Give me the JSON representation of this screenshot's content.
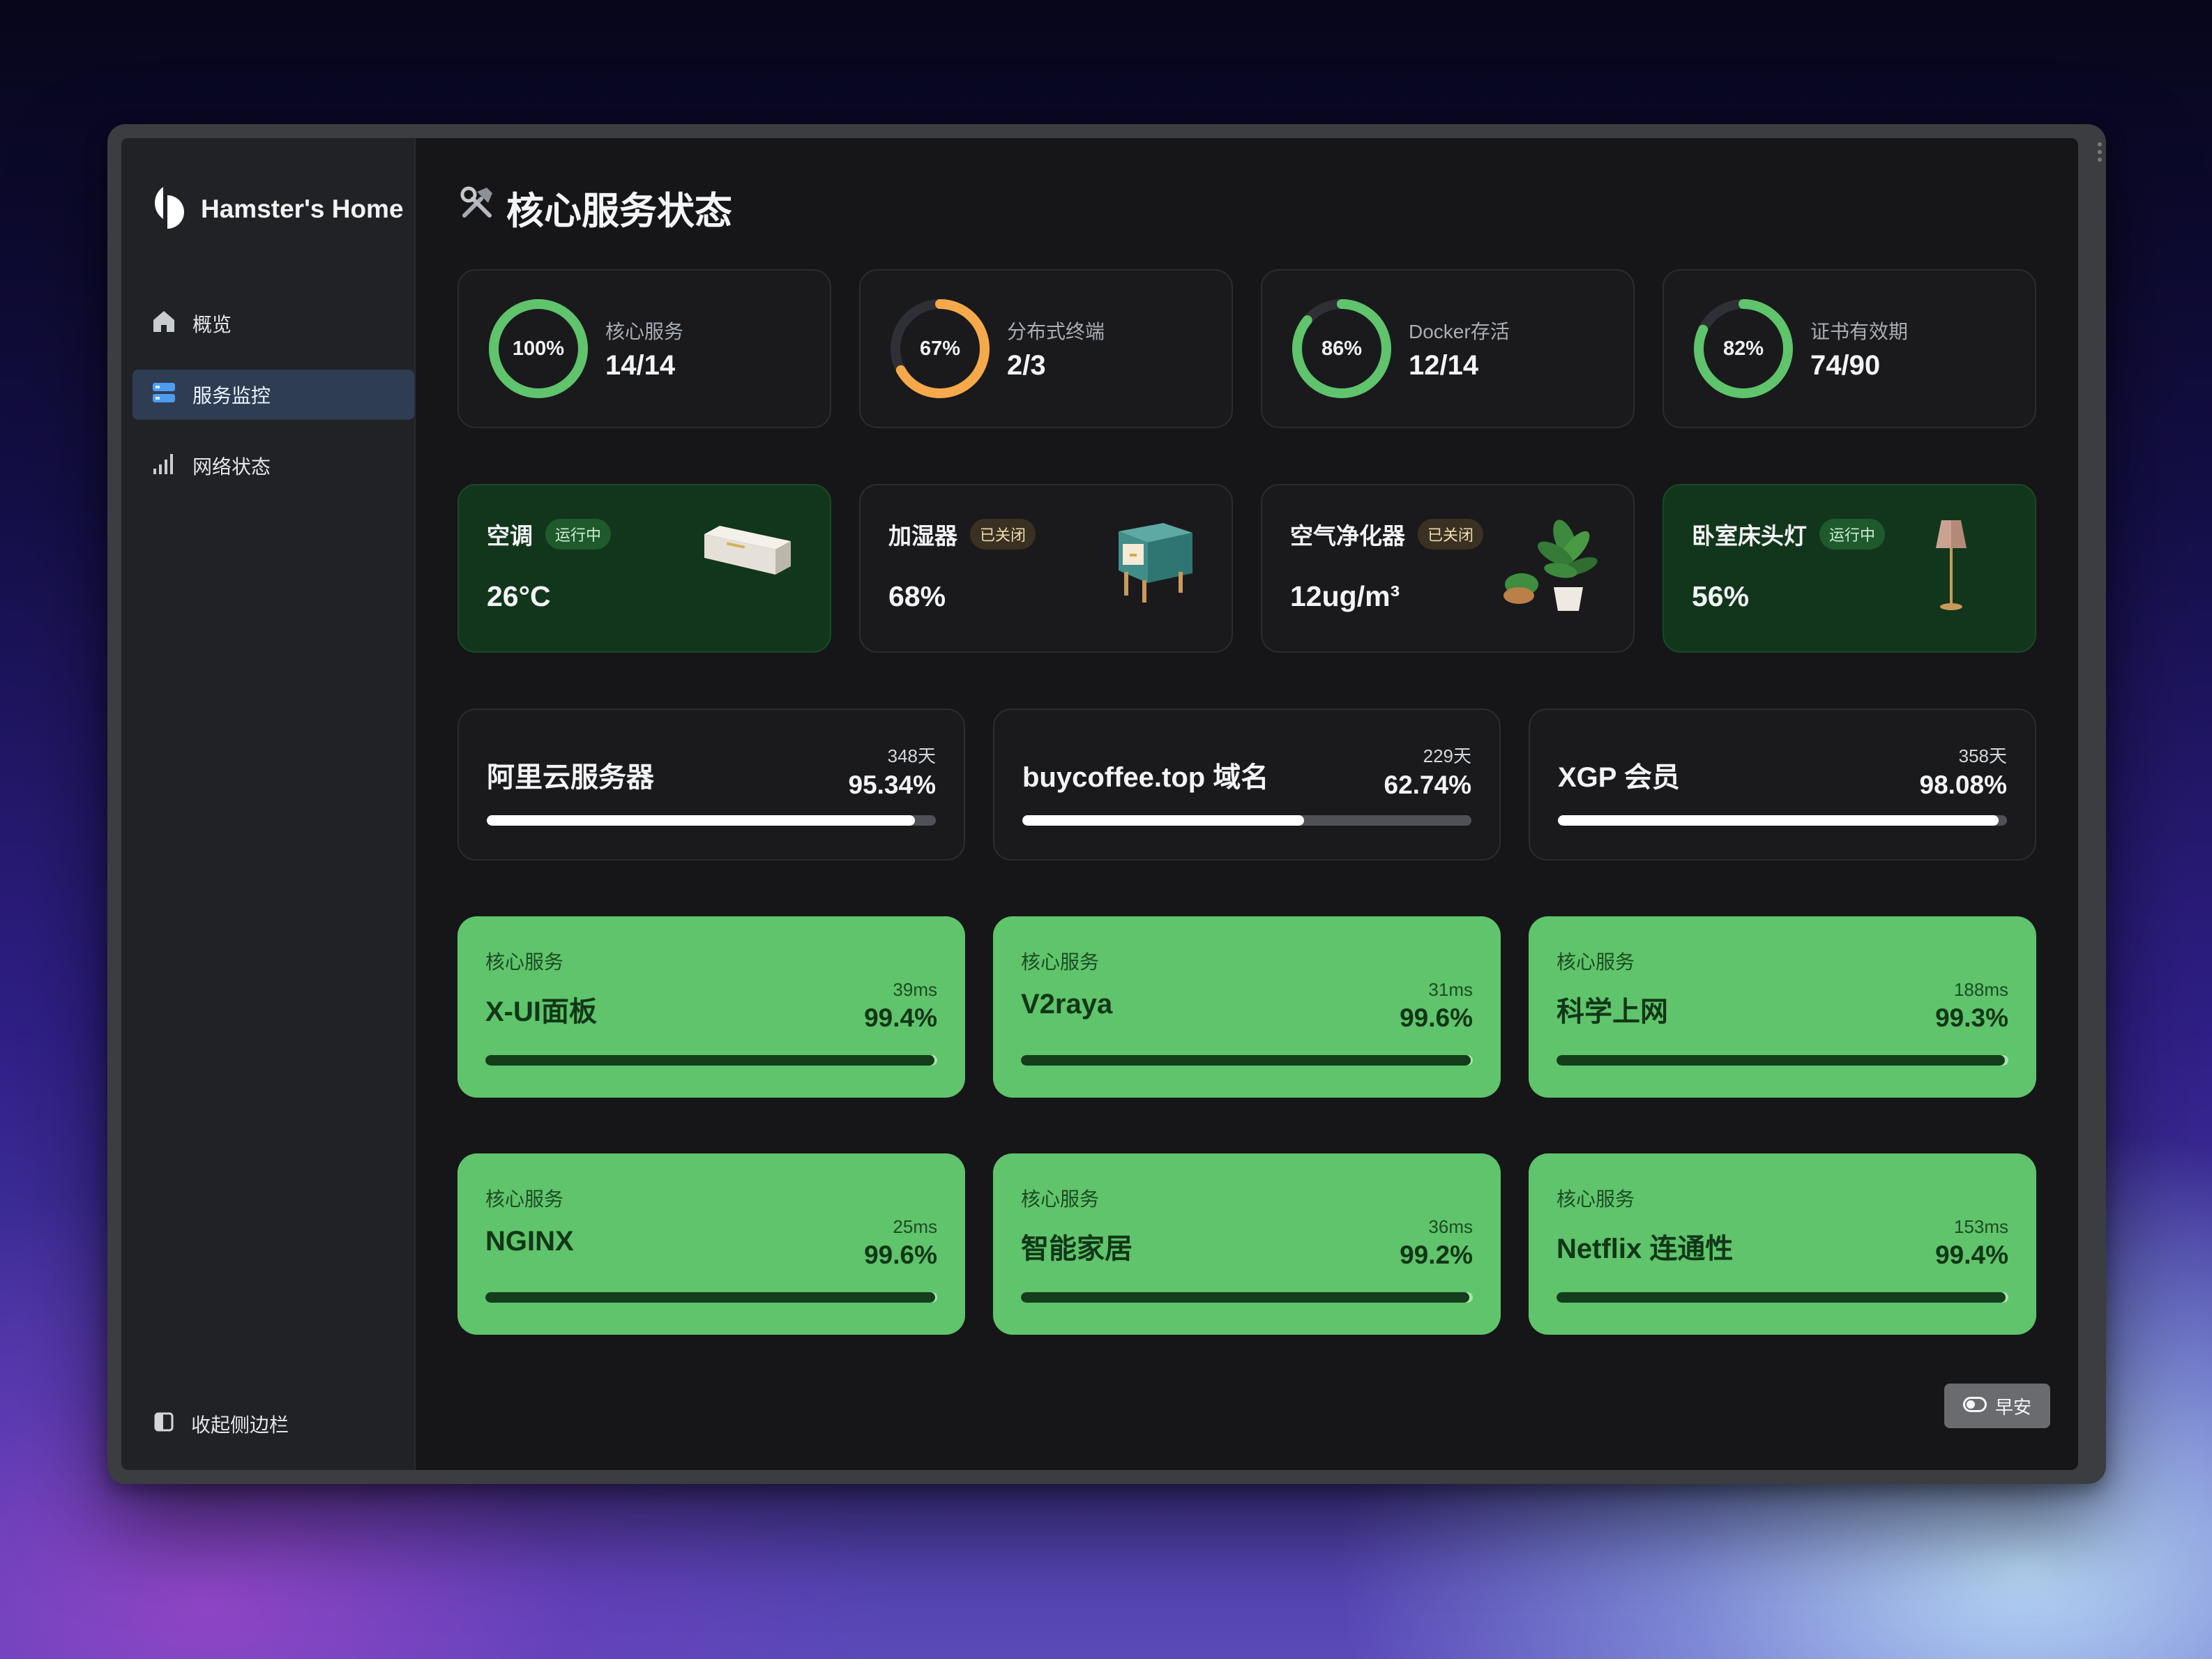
{
  "app": {
    "name": "Hamster's Home"
  },
  "sidebar": {
    "items": [
      {
        "label": "概览",
        "icon": "home-icon"
      },
      {
        "label": "服务监控",
        "icon": "server-icon",
        "active": true
      },
      {
        "label": "网络状态",
        "icon": "signal-icon"
      }
    ],
    "collapse_label": "收起侧边栏"
  },
  "page": {
    "title": "核心服务状态",
    "title_icon": "hammer-wrench-icon"
  },
  "stats": [
    {
      "ring_label": "100%",
      "progress": 1.0,
      "title": "核心服务",
      "value": "14/14",
      "color": "#5fc46b"
    },
    {
      "ring_label": "67%",
      "progress": 0.67,
      "title": "分布式终端",
      "value": "2/3",
      "color": "#f6a94a"
    },
    {
      "ring_label": "86%",
      "progress": 0.86,
      "title": "Docker存活",
      "value": "12/14",
      "color": "#5fc46b"
    },
    {
      "ring_label": "82%",
      "progress": 0.82,
      "title": "证书有效期",
      "value": "74/90",
      "color": "#5fc46b"
    }
  ],
  "devices": [
    {
      "name": "空调",
      "status": "运行中",
      "on": true,
      "value": "26°C",
      "image": "air-conditioner-image"
    },
    {
      "name": "加湿器",
      "status": "已关闭",
      "on": false,
      "value": "68%",
      "image": "humidifier-image"
    },
    {
      "name": "空气净化器",
      "status": "已关闭",
      "on": false,
      "value": "12ug/m³",
      "image": "plant-image"
    },
    {
      "name": "卧室床头灯",
      "status": "运行中",
      "on": true,
      "value": "56%",
      "image": "floor-lamp-image"
    }
  ],
  "subscriptions": [
    {
      "name": "阿里云服务器",
      "days": "348天",
      "percent": "95.34%",
      "progress": 0.9534
    },
    {
      "name": "buycoffee.top 域名",
      "days": "229天",
      "percent": "62.74%",
      "progress": 0.6274
    },
    {
      "name": "XGP 会员",
      "days": "358天",
      "percent": "98.08%",
      "progress": 0.9808
    }
  ],
  "services": [
    {
      "category": "核心服务",
      "name": "X-UI面板",
      "latency": "39ms",
      "uptime": "99.4%",
      "progress": 0.994
    },
    {
      "category": "核心服务",
      "name": "V2raya",
      "latency": "31ms",
      "uptime": "99.6%",
      "progress": 0.996
    },
    {
      "category": "核心服务",
      "name": "科学上网",
      "latency": "188ms",
      "uptime": "99.3%",
      "progress": 0.993
    },
    {
      "category": "核心服务",
      "name": "NGINX",
      "latency": "25ms",
      "uptime": "99.6%",
      "progress": 0.996
    },
    {
      "category": "核心服务",
      "name": "智能家居",
      "latency": "36ms",
      "uptime": "99.2%",
      "progress": 0.992
    },
    {
      "category": "核心服务",
      "name": "Netflix 连通性",
      "latency": "153ms",
      "uptime": "99.4%",
      "progress": 0.994
    }
  ],
  "theme_toggle": {
    "label": "早安",
    "icon": "toggle-icon"
  },
  "colors": {
    "accent_green": "#5fc46b",
    "accent_orange": "#f6a94a",
    "active_nav": "#2f3d52"
  }
}
